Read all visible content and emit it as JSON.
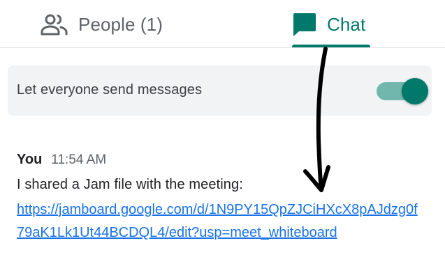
{
  "tabs": {
    "people": {
      "label": "People (1)",
      "icon": "people-icon"
    },
    "chat": {
      "label": "Chat",
      "icon": "chat-icon",
      "active": true
    }
  },
  "settings": {
    "send_messages_label": "Let everyone send messages",
    "send_messages_enabled": true
  },
  "message": {
    "sender": "You",
    "time": "11:54 AM",
    "text": "I shared a Jam file with the meeting:",
    "link": "https://jamboard.google.com/d/1N9PY15QpZJCiHXcX8pAJdzg0f79aK1Lk1Ut44BCDQL4/edit?usp=meet_whiteboard"
  },
  "colors": {
    "accent": "#00796b",
    "toggle_track": "#72b7ae",
    "link": "#1a73e8",
    "muted_text": "#5f6368",
    "card_bg": "#f1f3f4",
    "annotation": "#000000"
  }
}
